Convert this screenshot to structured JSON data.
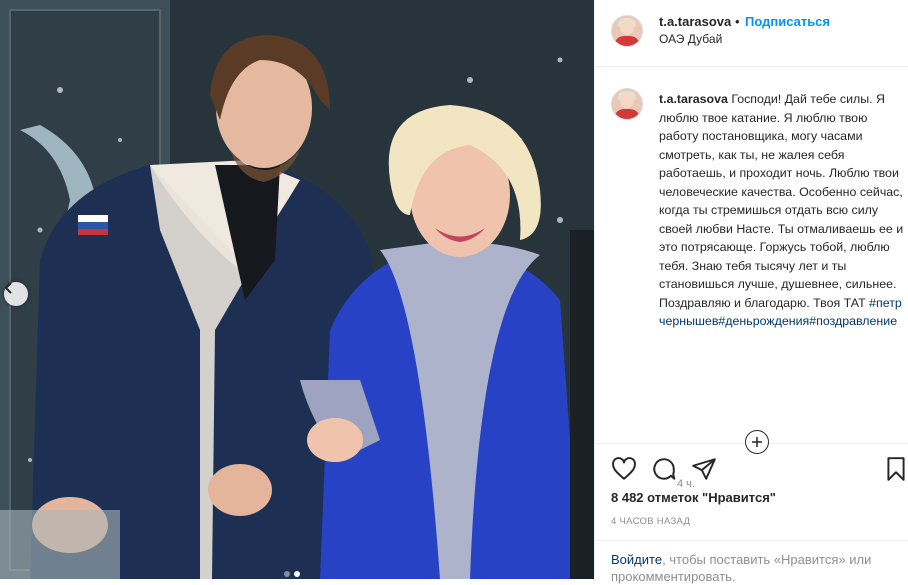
{
  "post": {
    "username": "t.a.tarasova",
    "separator": "•",
    "follow_label": "Подписаться",
    "location": "ОАЭ Дубай"
  },
  "caption": {
    "username": "t.a.tarasova",
    "text": "Господи! Дай тебе силы. Я люблю твое катание. Я люблю твою работу постановщика, могу часами смотреть, как ты, не жалея себя работаешь, и проходит ночь. Люблю твои человеческие качества. Особенно сейчас, когда ты стремишься отдать всю силу своей любви Насте. Ты отмаливаешь ее и это потрясающе. Горжусь тобой, люблю тебя. Знаю тебя тысячу лет и ты становишься лучше, душевнее, сильнее. Поздравляю и благодарю. Твоя ТАТ",
    "hashtags": "#петрчернышев#деньрождения#поздравление",
    "time": "4 ч."
  },
  "actions": {
    "like_icon": "heart-icon",
    "comment_icon": "comment-icon",
    "share_icon": "paper-plane-icon",
    "save_icon": "bookmark-icon"
  },
  "likes_text": "8 482 отметок \"Нравится\"",
  "posted_ago": "4 ЧАСОВ НАЗАД",
  "login_prompt": {
    "link": "Войдите",
    "text": ", чтобы поставить «Нравится» или прокомментировать."
  },
  "carousel": {
    "total": 2,
    "active": 2
  },
  "colors": {
    "accent": "#0095f6",
    "hashtag": "#00376b",
    "muted": "#8e8e8e"
  }
}
